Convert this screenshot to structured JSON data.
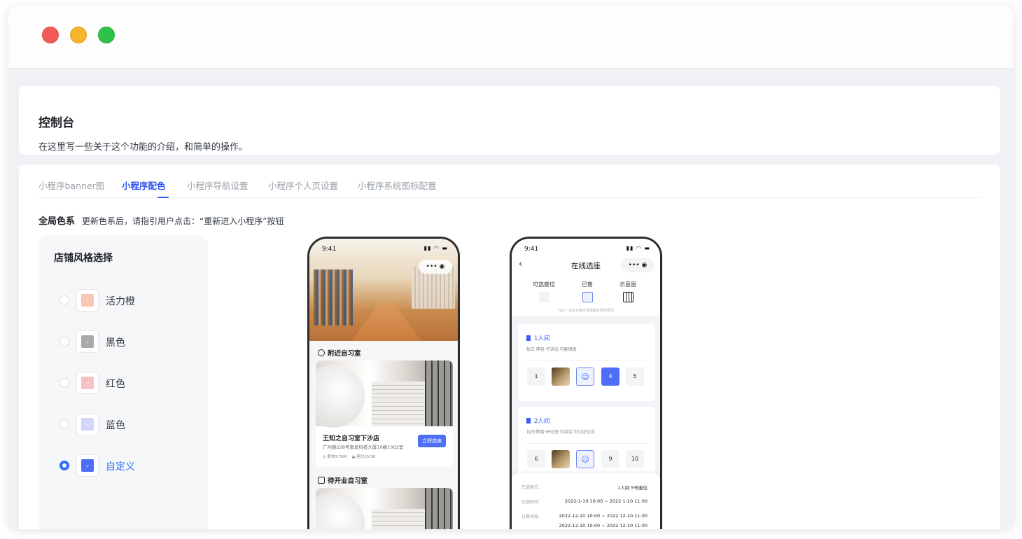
{
  "header": {
    "title": "控制台",
    "description": "在这里写一些关于这个功能的介绍，和简单的操作。"
  },
  "tabs": [
    {
      "label": "小程序banner图",
      "active": false
    },
    {
      "label": "小程序配色",
      "active": true
    },
    {
      "label": "小程序导航设置",
      "active": false
    },
    {
      "label": "小程序个人页设置",
      "active": false
    },
    {
      "label": "小程序系统图标配置",
      "active": false
    }
  ],
  "section": {
    "title": "全局色系",
    "note": "更新色系后，请指引用户点击：“重新进入小程序”按钮"
  },
  "style_panel": {
    "title": "店铺风格选择",
    "options": [
      {
        "label": "活力橙",
        "color": "#f7c6b4",
        "selected": false
      },
      {
        "label": "黑色",
        "color": "#a9a9a9",
        "selected": false
      },
      {
        "label": "红色",
        "color": "#f3c2c4",
        "selected": false
      },
      {
        "label": "蓝色",
        "color": "#cfd5fb",
        "selected": false
      },
      {
        "label": "自定义",
        "color": "#4f6ef7",
        "selected": true
      }
    ]
  },
  "phone1": {
    "time": "9:41",
    "capsule": "••• ◉",
    "nearby_title": "附近自习室",
    "store_name": "王知之自习室下沙店",
    "store_address": "广州路228号恩发科技大厦10楼1002室",
    "store_distance": "距你3.7KM",
    "store_seats": "座位25/36",
    "store_button": "立即选座",
    "upcoming_title": "待开业自习室"
  },
  "phone2": {
    "time": "9:41",
    "nav_title": "在线选座",
    "capsule": "••• ◉",
    "legend": [
      {
        "label": "可选座位"
      },
      {
        "label": "已售"
      },
      {
        "label": "示意图"
      }
    ],
    "tips": "Tips：点击头像可查看座位预定情况",
    "rooms": [
      {
        "title": "1人间",
        "subtitle": "独立·隔音·可讲话·可翻键盘",
        "seats": [
          "1",
          "",
          "",
          "4",
          "5"
        ]
      },
      {
        "title": "2人间",
        "subtitle": "包间·隔音·研讨室·可讲话·可讨论交流",
        "seats": [
          "6",
          "",
          "",
          "9",
          "10"
        ]
      }
    ],
    "info": [
      {
        "label": "已选座位:",
        "value": "1人间 5号座位"
      },
      {
        "label": "已选时间:",
        "value": "2022-1-10 10:00 ~ 2022 1-10 11:00"
      },
      {
        "label": "已售时段:",
        "value": "2022-12-10 10:00 ~ 2022 12-10 11:00"
      },
      {
        "label": "",
        "value": "2022-12-10 10:00 ~ 2022 12-10 11:00"
      }
    ]
  },
  "colors": {
    "accent": "#2f54eb",
    "custom": "#4f6ef7"
  }
}
